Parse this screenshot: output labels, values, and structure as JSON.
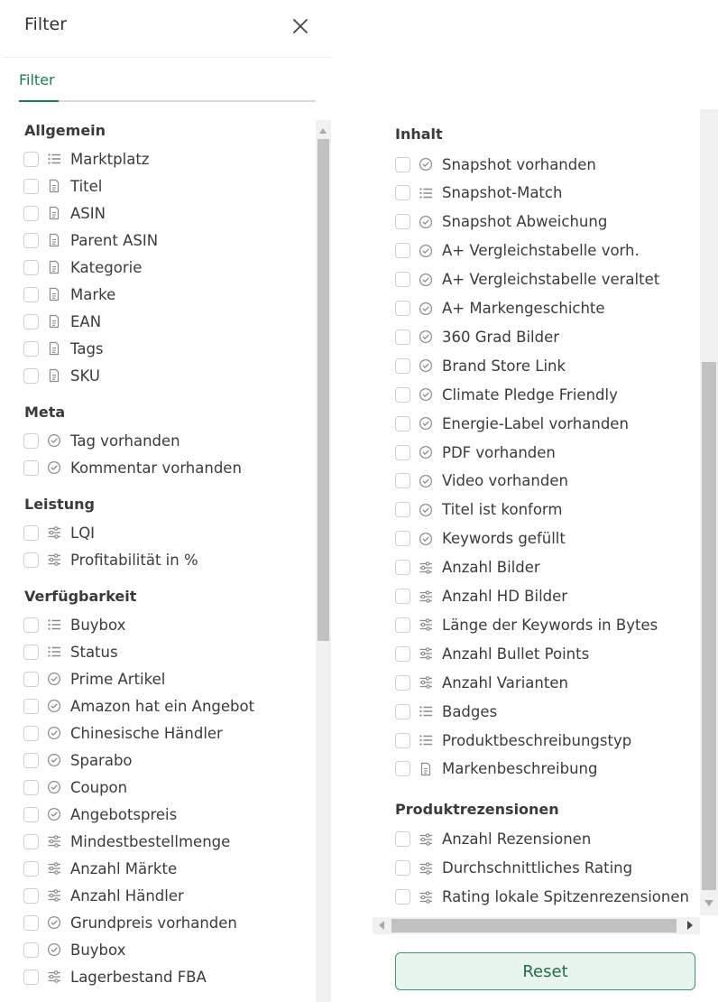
{
  "header": {
    "title": "Filter"
  },
  "tabs": [
    {
      "label": "Filter"
    }
  ],
  "left_panel": {
    "groups": [
      {
        "title": "Allgemein",
        "items": [
          {
            "label": "Marktplatz",
            "icon": "list-icon"
          },
          {
            "label": "Titel",
            "icon": "document-icon"
          },
          {
            "label": "ASIN",
            "icon": "document-icon"
          },
          {
            "label": "Parent ASIN",
            "icon": "document-icon"
          },
          {
            "label": "Kategorie",
            "icon": "document-icon"
          },
          {
            "label": "Marke",
            "icon": "document-icon"
          },
          {
            "label": "EAN",
            "icon": "document-icon"
          },
          {
            "label": "Tags",
            "icon": "document-icon"
          },
          {
            "label": "SKU",
            "icon": "document-icon"
          }
        ]
      },
      {
        "title": "Meta",
        "items": [
          {
            "label": "Tag vorhanden",
            "icon": "check-circle-icon"
          },
          {
            "label": "Kommentar vorhanden",
            "icon": "check-circle-icon"
          }
        ]
      },
      {
        "title": "Leistung",
        "items": [
          {
            "label": "LQI",
            "icon": "sliders-icon"
          },
          {
            "label": "Profitabilität in %",
            "icon": "sliders-icon"
          }
        ]
      },
      {
        "title": "Verfügbarkeit",
        "items": [
          {
            "label": "Buybox",
            "icon": "list-icon"
          },
          {
            "label": "Status",
            "icon": "list-icon"
          },
          {
            "label": "Prime Artikel",
            "icon": "check-circle-icon"
          },
          {
            "label": "Amazon hat ein Angebot",
            "icon": "check-circle-icon"
          },
          {
            "label": "Chinesische Händler",
            "icon": "check-circle-icon"
          },
          {
            "label": "Sparabo",
            "icon": "check-circle-icon"
          },
          {
            "label": "Coupon",
            "icon": "check-circle-icon"
          },
          {
            "label": "Angebotspreis",
            "icon": "check-circle-icon"
          },
          {
            "label": "Mindestbestellmenge",
            "icon": "sliders-icon"
          },
          {
            "label": "Anzahl Märkte",
            "icon": "sliders-icon"
          },
          {
            "label": "Anzahl Händler",
            "icon": "sliders-icon"
          },
          {
            "label": "Grundpreis vorhanden",
            "icon": "check-circle-icon"
          },
          {
            "label": "Buybox",
            "icon": "check-circle-icon"
          },
          {
            "label": "Lagerbestand FBA",
            "icon": "sliders-icon"
          }
        ]
      }
    ]
  },
  "right_panel": {
    "groups": [
      {
        "title": "Inhalt",
        "items": [
          {
            "label": "Snapshot vorhanden",
            "icon": "check-circle-icon"
          },
          {
            "label": "Snapshot-Match",
            "icon": "list-icon"
          },
          {
            "label": "Snapshot Abweichung",
            "icon": "check-circle-icon"
          },
          {
            "label": "A+ Vergleichstabelle vorh.",
            "icon": "check-circle-icon"
          },
          {
            "label": "A+ Vergleichstabelle veraltet",
            "icon": "check-circle-icon"
          },
          {
            "label": "A+ Markengeschichte",
            "icon": "check-circle-icon"
          },
          {
            "label": "360 Grad Bilder",
            "icon": "check-circle-icon"
          },
          {
            "label": "Brand Store Link",
            "icon": "check-circle-icon"
          },
          {
            "label": "Climate Pledge Friendly",
            "icon": "check-circle-icon"
          },
          {
            "label": "Energie-Label vorhanden",
            "icon": "check-circle-icon"
          },
          {
            "label": "PDF vorhanden",
            "icon": "check-circle-icon"
          },
          {
            "label": "Video vorhanden",
            "icon": "check-circle-icon"
          },
          {
            "label": "Titel ist konform",
            "icon": "check-circle-icon"
          },
          {
            "label": "Keywords gefüllt",
            "icon": "check-circle-icon"
          },
          {
            "label": "Anzahl Bilder",
            "icon": "sliders-icon"
          },
          {
            "label": "Anzahl HD Bilder",
            "icon": "sliders-icon"
          },
          {
            "label": "Länge der Keywords in Bytes",
            "icon": "sliders-icon"
          },
          {
            "label": "Anzahl Bullet Points",
            "icon": "sliders-icon"
          },
          {
            "label": "Anzahl Varianten",
            "icon": "sliders-icon"
          },
          {
            "label": "Badges",
            "icon": "list-icon"
          },
          {
            "label": "Produktbeschreibungstyp",
            "icon": "list-icon"
          },
          {
            "label": "Markenbeschreibung",
            "icon": "document-icon"
          }
        ]
      },
      {
        "title": "Produktrezensionen",
        "items": [
          {
            "label": "Anzahl Rezensionen",
            "icon": "sliders-icon"
          },
          {
            "label": "Durchschnittliches Rating",
            "icon": "sliders-icon"
          },
          {
            "label": "Rating lokale Spitzenrezensionen",
            "icon": "sliders-icon"
          }
        ]
      }
    ]
  },
  "footer": {
    "reset_label": "Reset"
  },
  "colors": {
    "accent": "#1a7f52",
    "reset_bg": "#e8f5ee",
    "reset_border": "#3c9a6a"
  }
}
